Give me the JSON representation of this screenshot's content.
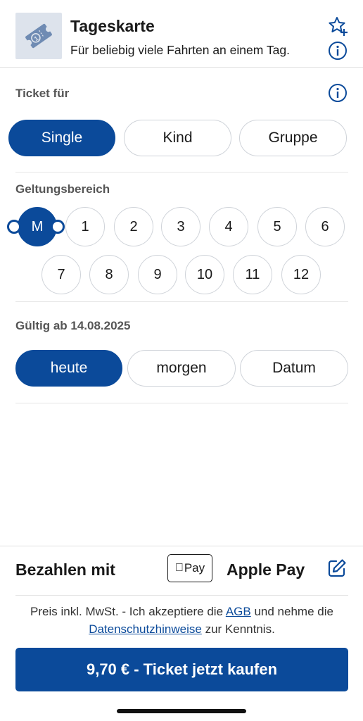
{
  "header": {
    "title": "Tageskarte",
    "subtitle": "Für beliebig viele Fahrten an einem Tag.",
    "icons": [
      "ticket-icon",
      "star-plus-icon",
      "info-icon"
    ]
  },
  "ticket_for": {
    "label": "Ticket für",
    "options": [
      "Single",
      "Kind",
      "Gruppe"
    ],
    "selected": "Single"
  },
  "zones": {
    "label": "Geltungsbereich",
    "row1": [
      "M",
      "1",
      "2",
      "3",
      "4",
      "5",
      "6"
    ],
    "row2": [
      "7",
      "8",
      "9",
      "10",
      "11",
      "12"
    ],
    "selected": "M"
  },
  "valid_from": {
    "label": "Gültig ab 14.08.2025",
    "options": [
      "heute",
      "morgen",
      "Datum"
    ],
    "selected": "heute"
  },
  "payment": {
    "label": "Bezahlen mit",
    "badge": "Pay",
    "method": "Apple Pay"
  },
  "legal": {
    "part1": "Preis inkl. MwSt. - Ich akzeptiere die ",
    "agb": "AGB",
    "part2": " und nehme die ",
    "privacy": "Datenschutzhinweise",
    "part3": " zur Kenntnis."
  },
  "buy_button": "9,70 € - Ticket jetzt kaufen",
  "colors": {
    "primary": "#0b4a9a",
    "border": "#cfd3d9"
  }
}
